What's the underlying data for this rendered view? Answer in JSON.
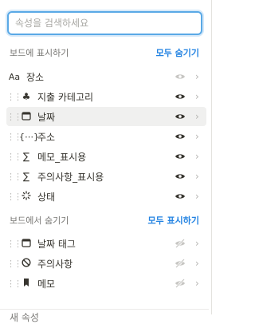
{
  "search": {
    "placeholder": "속성을 검색하세요"
  },
  "shown_section": {
    "title": "보드에 표시하기",
    "action": "모두 숨기기"
  },
  "hidden_section": {
    "title": "보드에서 숨기기",
    "action": "모두 표시하기"
  },
  "shown_items": [
    {
      "label": "장소",
      "icon": "text-aa-icon",
      "visible": true,
      "locked": true
    },
    {
      "label": "지출 카테고리",
      "icon": "shapes-icon",
      "visible": true
    },
    {
      "label": "날짜",
      "icon": "calendar-icon",
      "visible": true,
      "highlighted": true
    },
    {
      "label": "주소",
      "icon": "formula-icon",
      "visible": true
    },
    {
      "label": "메모_표시용",
      "icon": "sigma-icon",
      "visible": true
    },
    {
      "label": "주의사항_표시용",
      "icon": "sigma-icon",
      "visible": true
    },
    {
      "label": "상태",
      "icon": "status-icon",
      "visible": true
    }
  ],
  "hidden_items": [
    {
      "label": "날짜 태그",
      "icon": "calendar-icon",
      "visible": false
    },
    {
      "label": "주의사항",
      "icon": "prohibited-icon",
      "visible": false
    },
    {
      "label": "메모",
      "icon": "bookmark-icon",
      "visible": false
    }
  ],
  "footer_peek": "새 속성"
}
